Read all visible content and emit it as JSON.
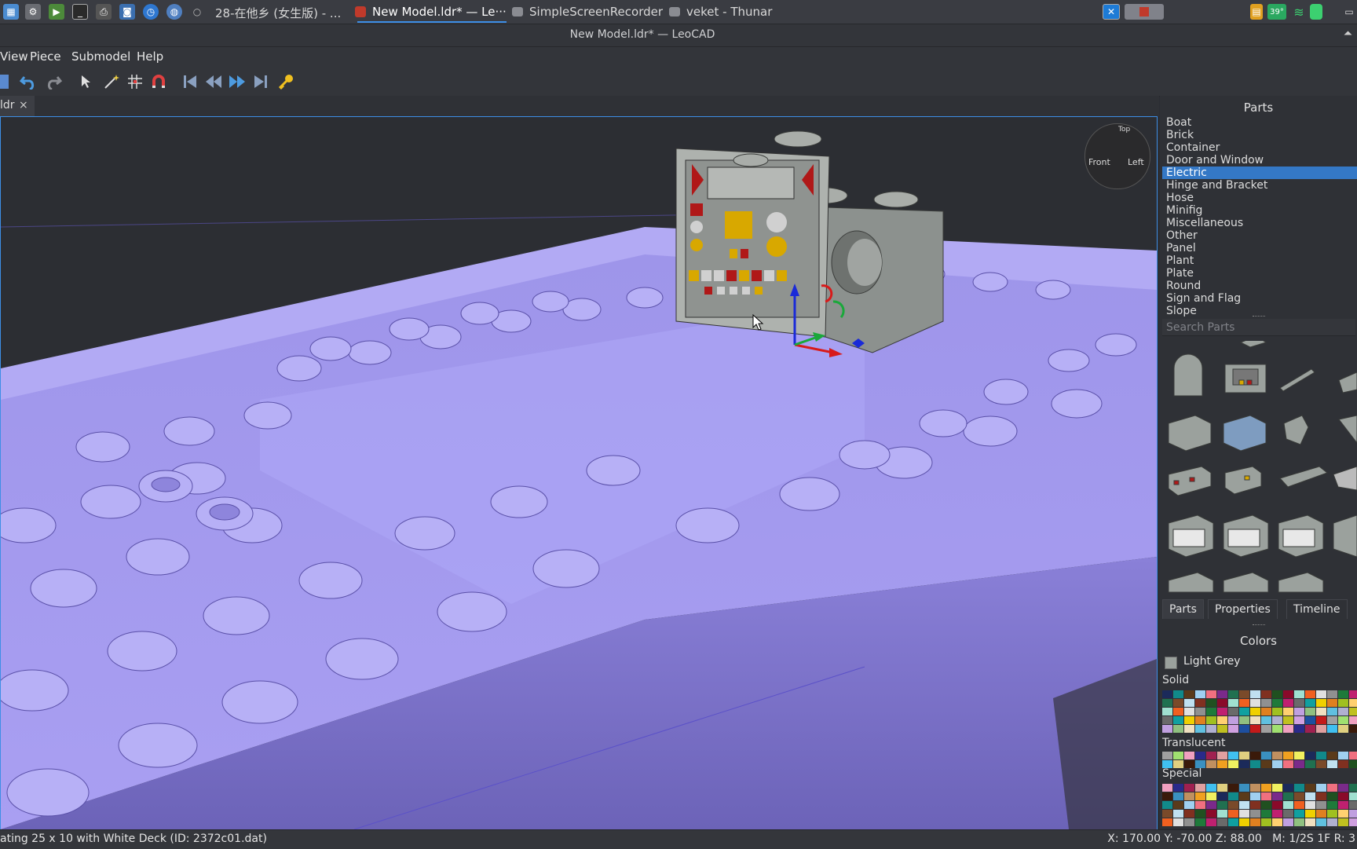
{
  "taskbar": {
    "tasks": [
      {
        "label": "28-在他乡 (女生版) - ...",
        "active": false
      },
      {
        "label": "New Model.ldr* — Le···",
        "active": true
      },
      {
        "label": "SimpleScreenRecorder",
        "active": false
      },
      {
        "label": "veket - Thunar",
        "active": false
      }
    ],
    "tray_badge": "39°"
  },
  "window": {
    "title": "New Model.ldr* — LeoCAD"
  },
  "menu": {
    "items": [
      "View",
      "Piece",
      "Submodel",
      "Help"
    ]
  },
  "tab": {
    "label": "ldr",
    "close": "×"
  },
  "viewcube": {
    "top": "Top",
    "front": "Front",
    "left": "Left"
  },
  "parts_panel": {
    "title": "Parts",
    "categories": [
      "Boat",
      "Brick",
      "Container",
      "Door and Window",
      "Electric",
      "Hinge and Bracket",
      "Hose",
      "Minifig",
      "Miscellaneous",
      "Other",
      "Panel",
      "Plant",
      "Plate",
      "Round",
      "Sign and Flag",
      "Slope"
    ],
    "selected_index": 4,
    "search_placeholder": "Search Parts",
    "tabs": [
      "Parts",
      "Properties",
      "Timeline"
    ]
  },
  "colors_panel": {
    "title": "Colors",
    "current_color": "Light Grey",
    "current_hex": "#9ba19d",
    "sections": [
      "Solid",
      "Translucent",
      "Special"
    ]
  },
  "status": {
    "message": "ating 25 x 10 with White Deck (ID: 2372c01.dat)",
    "coords": "X: 170.00 Y: -70.00 Z: 88.00   M: 1/2S 1F R: 3"
  },
  "colors": {
    "accent": "#3478c6",
    "baseplate": "#a79df0",
    "background": "#2c2e33"
  }
}
